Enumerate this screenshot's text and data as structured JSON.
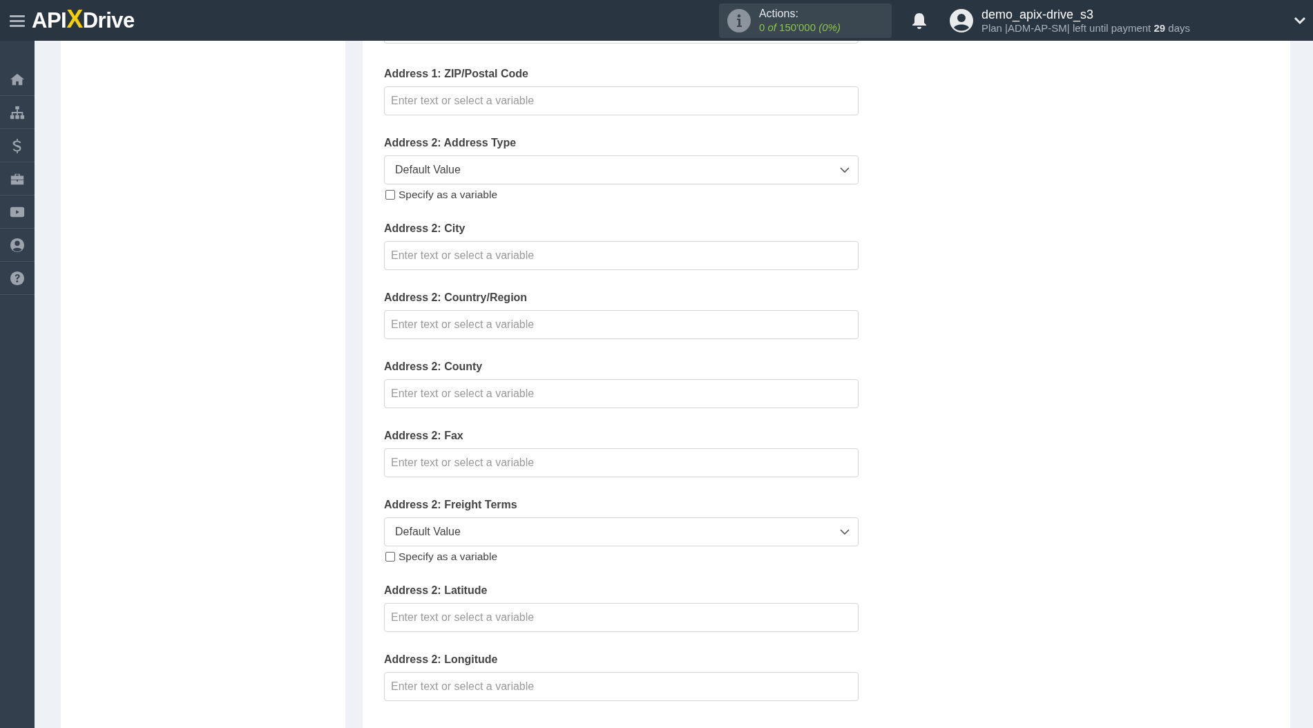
{
  "logo": {
    "part_1": "API",
    "part_2": "X",
    "part_3": "Drive"
  },
  "actions": {
    "label": "Actions:",
    "usage": "0 *of* 150'000 *(0%)*"
  },
  "user": {
    "name": "demo_apix-drive_s3",
    "plan": "Plan |ADM-AP-SM| left until payment **29** days"
  },
  "sidebar": {
    "items": [
      {
        "kind": "home"
      },
      {
        "kind": "sitemap"
      },
      {
        "kind": "dollar"
      },
      {
        "kind": "briefcase"
      },
      {
        "kind": "video"
      },
      {
        "kind": "user"
      },
      {
        "kind": "help"
      }
    ]
  },
  "fields": [
    {
      "kind": "text",
      "label": "Address 1: ZIP/Postal Code",
      "placeholder": "Enter text or select a variable"
    },
    {
      "kind": "select",
      "label": "Address 2: Address Type",
      "value": "Default Value",
      "checkbox": {
        "label": "Specify as a variable",
        "checked": false
      }
    },
    {
      "kind": "text",
      "label": "Address 2: City",
      "placeholder": "Enter text or select a variable"
    },
    {
      "kind": "text",
      "label": "Address 2: Country/Region",
      "placeholder": "Enter text or select a variable"
    },
    {
      "kind": "text",
      "label": "Address 2: County",
      "placeholder": "Enter text or select a variable"
    },
    {
      "kind": "text",
      "label": "Address 2: Fax",
      "placeholder": "Enter text or select a variable"
    },
    {
      "kind": "select",
      "label": "Address 2: Freight Terms",
      "value": "Default Value",
      "checkbox": {
        "label": "Specify as a variable",
        "checked": false
      }
    },
    {
      "kind": "text",
      "label": "Address 2: Latitude",
      "placeholder": "Enter text or select a variable"
    },
    {
      "kind": "text",
      "label": "Address 2: Longitude",
      "placeholder": "Enter text or select a variable"
    }
  ]
}
